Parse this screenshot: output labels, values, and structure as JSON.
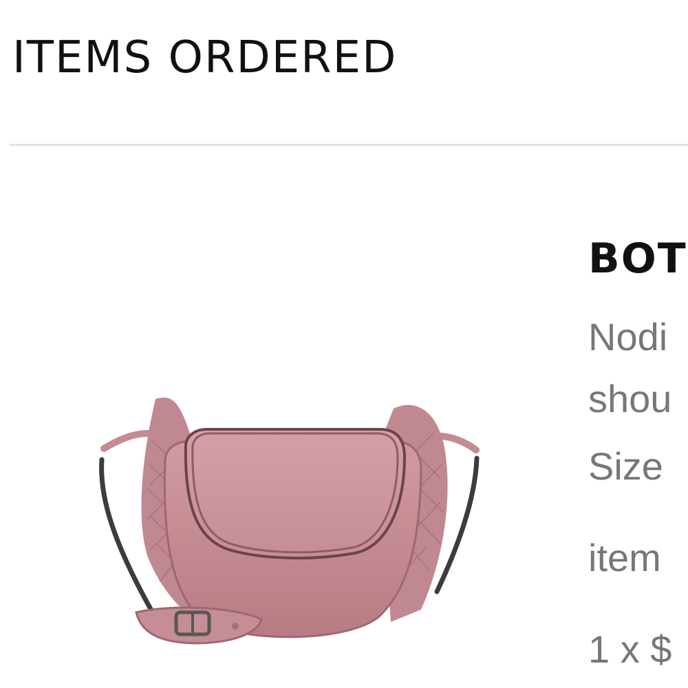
{
  "section": {
    "title": "ITEMS ORDERED"
  },
  "product": {
    "image_icon": "pink-leather-crossbody-bag",
    "colors": {
      "bag": "#c48b93",
      "bag_dark": "#a46f78",
      "strap": "#3f3a3c",
      "hardware": "#5a5557"
    },
    "brand": "BOTT",
    "description_line_1": "Nodi",
    "description_line_2": "shou",
    "size_label": "Size",
    "item_label": "item",
    "price_line": "1 x $"
  }
}
